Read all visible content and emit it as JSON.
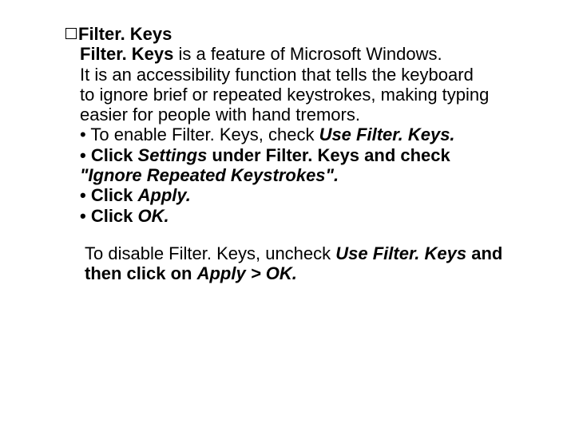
{
  "title": "Filter. Keys",
  "p1a": "Filter. Keys",
  "p1b": " is a feature of Microsoft Windows.",
  "p2": "It is an accessibility function that tells the keyboard",
  "p3": "to ignore brief or repeated keystrokes, making typing easier for people with hand tremors.",
  "l1a": "• To enable Filter. Keys, check ",
  "l1b": "Use Filter. Keys.",
  "l2a": "• Click ",
  "l2b": "Settings",
  "l2c": " under Filter. Keys and check ",
  "l2d": "\"Ignore Repeated Keystrokes\".",
  "l3a": "• Click ",
  "l3b": "Apply.",
  "l4a": "• Click ",
  "l4b": "OK.",
  "f1": " To disable Filter. Keys, uncheck ",
  "f2": "Use Filter. Keys",
  "f3": " and then click on ",
  "f4": "Apply > OK."
}
